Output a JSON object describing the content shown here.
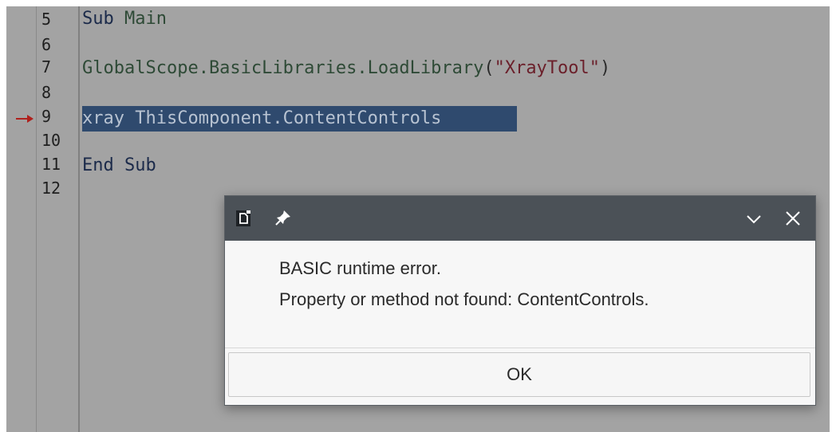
{
  "editor": {
    "line_numbers": [
      "5",
      "6",
      "7",
      "8",
      "9",
      "10",
      "11",
      "12"
    ],
    "lines": {
      "l5_kw": "Sub",
      "l5_name": "Main",
      "l7_call": "GlobalScope.BasicLibraries.LoadLibrary",
      "l7_open": "(",
      "l7_str": "\"XrayTool\"",
      "l7_close": ")",
      "l9_highlighted": "xray ThisComponent.ContentControls",
      "l11_kw": "End Sub"
    },
    "current_line_marker": "arrow-right-icon",
    "colors": {
      "selection": "#2f4a6e",
      "marker": "#b0201c"
    }
  },
  "dialog": {
    "title_icons": [
      "document-icon",
      "pin-icon"
    ],
    "controls": [
      "chevron-down-icon",
      "close-icon"
    ],
    "message_line1": "BASIC runtime error.",
    "message_line2": "Property or method not found: ContentControls.",
    "ok_label": "OK",
    "colors": {
      "titlebar": "#4b5157",
      "body": "#f7f7f7"
    }
  }
}
